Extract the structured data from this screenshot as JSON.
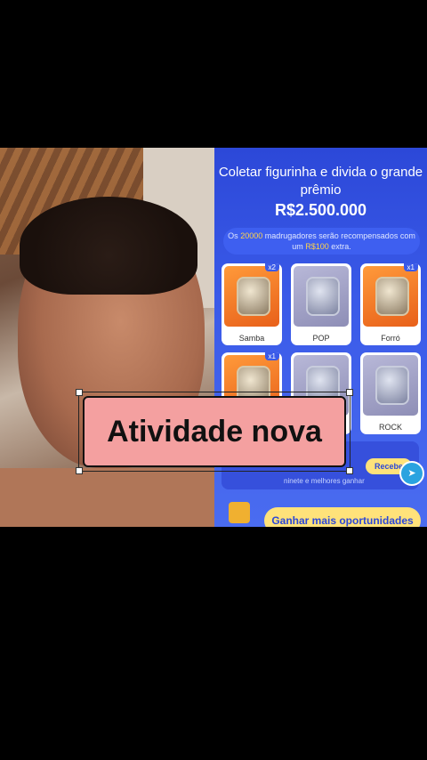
{
  "game": {
    "title": "Coletar figurinha e divida o grande prêmio",
    "prize": "R$2.500.000",
    "notice_prefix": "Os",
    "notice_count": "20000",
    "notice_middle": "madrugadores serão recompensados com um",
    "notice_reward": "R$100",
    "notice_suffix": "extra.",
    "cards": [
      {
        "label": "Samba",
        "badge": "x2",
        "locked": false
      },
      {
        "label": "POP",
        "badge": "",
        "locked": true
      },
      {
        "label": "Forró",
        "badge": "x1",
        "locked": false
      },
      {
        "label": "",
        "badge": "x1",
        "locked": false
      },
      {
        "label": "",
        "badge": "",
        "locked": true
      },
      {
        "label": "ROCK",
        "badge": "",
        "locked": true
      }
    ],
    "lower_text": "ninete e melhores ganhar",
    "receive_label": "Recebe",
    "more_label": "Ganhar mais oportunidades"
  },
  "overlay": {
    "caption": "Atividade nova"
  },
  "colors": {
    "game_bg": "#2c48d8",
    "caption_bg": "#f4a0a0",
    "button_yellow": "#ffe27a"
  }
}
